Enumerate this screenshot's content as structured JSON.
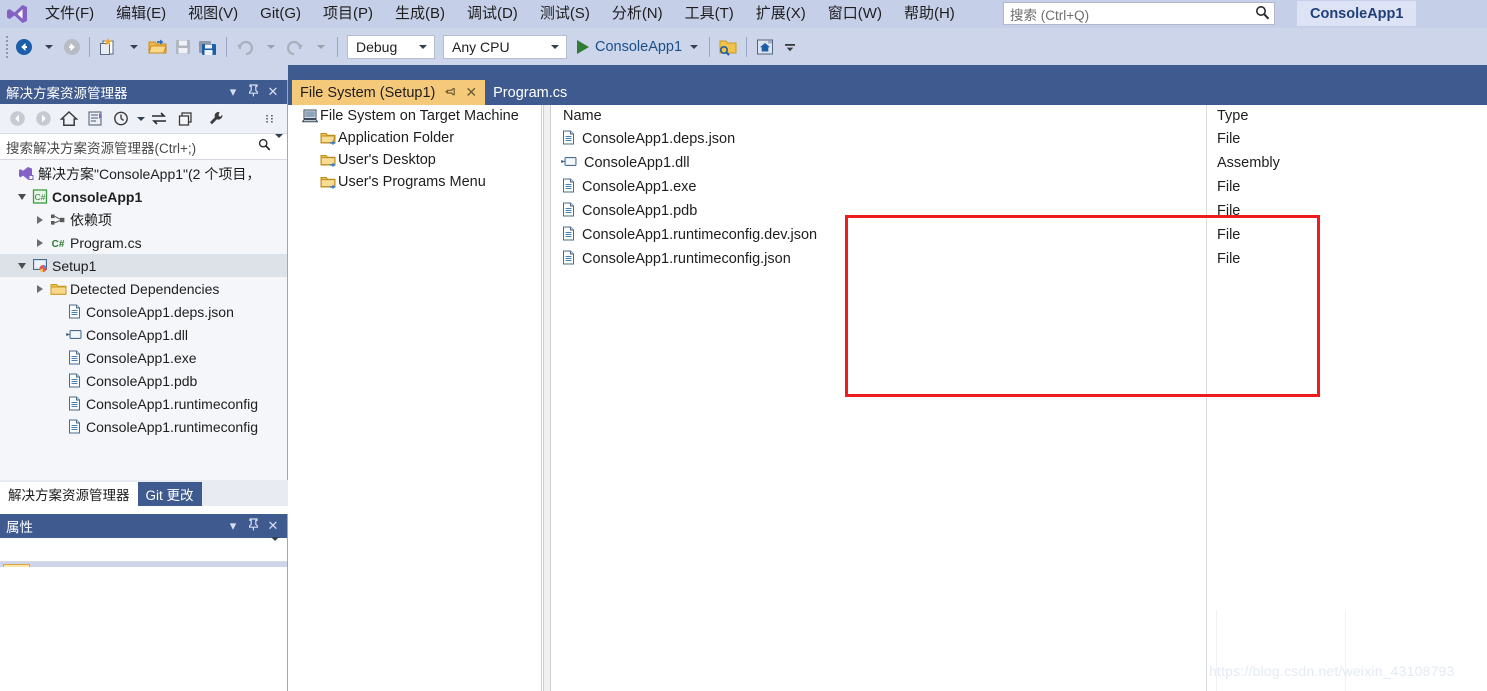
{
  "menu": {
    "logo_icon": "visual-studio-logo",
    "items": [
      {
        "label": "文件(F)"
      },
      {
        "label": "编辑(E)"
      },
      {
        "label": "视图(V)"
      },
      {
        "label": "Git(G)"
      },
      {
        "label": "项目(P)"
      },
      {
        "label": "生成(B)"
      },
      {
        "label": "调试(D)"
      },
      {
        "label": "测试(S)"
      },
      {
        "label": "分析(N)"
      },
      {
        "label": "工具(T)"
      },
      {
        "label": "扩展(X)"
      },
      {
        "label": "窗口(W)"
      },
      {
        "label": "帮助(H)"
      }
    ],
    "search": {
      "placeholder": "搜索 (Ctrl+Q)",
      "icon": "search-icon"
    },
    "project_badge": "ConsoleApp1"
  },
  "toolbar": {
    "nav_back_icon": "arrow-back-icon",
    "nav_forward_icon": "arrow-forward-icon",
    "new_item_icon": "new-item-icon",
    "open_file_icon": "open-folder-icon",
    "save_icon": "save-icon",
    "save_all_icon": "save-all-icon",
    "undo_icon": "undo-icon",
    "redo_icon": "redo-icon",
    "configuration": "Debug",
    "platform": "Any CPU",
    "start_label": "ConsoleApp1",
    "start_icon": "play-icon",
    "search_folder_icon": "find-in-files-icon",
    "home_icon": "home-window-icon",
    "overflow_icon": "toolbar-overflow-icon"
  },
  "solution_explorer": {
    "title": "解决方案资源管理器",
    "title_buttons": {
      "menu": "▾",
      "pin": "pin-icon",
      "close": "✕"
    },
    "toolbar_icons": [
      "back-icon",
      "forward-icon",
      "home-icon",
      "sync-with-active-doc-icon",
      "pending-changes-icon",
      "collapse-all-icon",
      "show-all-files-icon",
      "properties-icon",
      "overflow-icon"
    ],
    "search_placeholder": "搜索解决方案资源管理器(Ctrl+;)",
    "tree": [
      {
        "label": "解决方案\"ConsoleApp1\"(2 个项目，",
        "indent": 0,
        "icon": "solution-icon",
        "arrow": "none",
        "bold": false,
        "selected": false
      },
      {
        "label": "ConsoleApp1",
        "indent": 1,
        "icon": "csharp-project-icon",
        "arrow": "open",
        "bold": true,
        "selected": false
      },
      {
        "label": "依赖项",
        "indent": 2,
        "icon": "dependencies-icon",
        "arrow": "closed",
        "bold": false,
        "selected": false
      },
      {
        "label": "Program.cs",
        "indent": 2,
        "icon": "csharp-file-icon",
        "arrow": "closed",
        "bold": false,
        "selected": false
      },
      {
        "label": "Setup1",
        "indent": 1,
        "icon": "setup-project-icon",
        "arrow": "open",
        "bold": false,
        "selected": true
      },
      {
        "label": "Detected Dependencies",
        "indent": 2,
        "icon": "folder-icon",
        "arrow": "closed",
        "bold": false,
        "selected": false
      },
      {
        "label": "ConsoleApp1.deps.json",
        "indent": 3,
        "icon": "file-icon",
        "arrow": "none",
        "bold": false,
        "selected": false
      },
      {
        "label": "ConsoleApp1.dll",
        "indent": 3,
        "icon": "assembly-icon",
        "arrow": "none",
        "bold": false,
        "selected": false
      },
      {
        "label": "ConsoleApp1.exe",
        "indent": 3,
        "icon": "file-icon",
        "arrow": "none",
        "bold": false,
        "selected": false
      },
      {
        "label": "ConsoleApp1.pdb",
        "indent": 3,
        "icon": "file-icon",
        "arrow": "none",
        "bold": false,
        "selected": false
      },
      {
        "label": "ConsoleApp1.runtimeconfig",
        "indent": 3,
        "icon": "file-icon",
        "arrow": "none",
        "bold": false,
        "selected": false
      },
      {
        "label": "ConsoleApp1.runtimeconfig",
        "indent": 3,
        "icon": "file-icon",
        "arrow": "none",
        "bold": false,
        "selected": false
      }
    ],
    "bottom_tabs": [
      {
        "label": "解决方案资源管理器",
        "active": true
      },
      {
        "label": "Git 更改",
        "active": false
      }
    ]
  },
  "properties_panel": {
    "title": "属性",
    "title_buttons": {
      "menu": "▾",
      "pin": "pin-icon",
      "close": "✕"
    },
    "object_selector_value": "",
    "toolbar_icons": [
      "categorized-icon",
      "alphabetical-icon",
      "property-pages-icon"
    ]
  },
  "document_tabs": [
    {
      "label": "File System (Setup1)",
      "active": true,
      "pin_icon": "pin-icon",
      "close_icon": "close-icon"
    },
    {
      "label": "Program.cs",
      "active": false
    }
  ],
  "file_system_designer": {
    "folder_tree": [
      {
        "label": "File System on Target Machine",
        "indent": 0,
        "icon": "target-machine-icon"
      },
      {
        "label": "Application Folder",
        "indent": 1,
        "icon": "special-folder-icon"
      },
      {
        "label": "User's Desktop",
        "indent": 1,
        "icon": "special-folder-icon"
      },
      {
        "label": "User's Programs Menu",
        "indent": 1,
        "icon": "special-folder-icon"
      }
    ],
    "columns": [
      "Name",
      "Type"
    ],
    "rows": [
      {
        "name": "ConsoleApp1.deps.json",
        "type": "File",
        "icon": "file-icon"
      },
      {
        "name": "ConsoleApp1.dll",
        "type": "Assembly",
        "icon": "assembly-icon"
      },
      {
        "name": "ConsoleApp1.exe",
        "type": "File",
        "icon": "file-icon"
      },
      {
        "name": "ConsoleApp1.pdb",
        "type": "File",
        "icon": "file-icon"
      },
      {
        "name": "ConsoleApp1.runtimeconfig.dev.json",
        "type": "File",
        "icon": "file-icon"
      },
      {
        "name": "ConsoleApp1.runtimeconfig.json",
        "type": "File",
        "icon": "file-icon"
      }
    ],
    "highlight_color": "#ee1c1c"
  },
  "watermark": "https://blog.csdn.net/weixin_43108793"
}
